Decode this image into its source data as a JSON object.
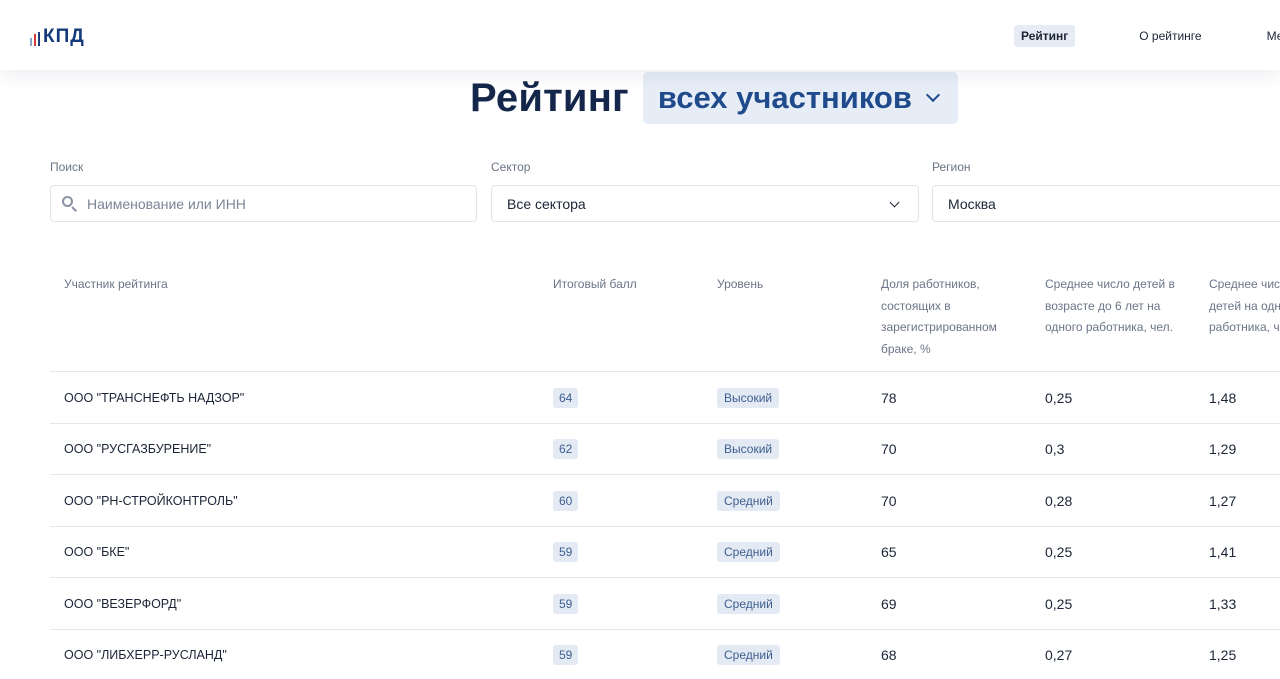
{
  "header": {
    "logo_text": "КПД",
    "nav": [
      {
        "label": "Рейтинг",
        "active": true
      },
      {
        "label": "О рейтинге",
        "active": false
      },
      {
        "label": "Мето",
        "active": false
      }
    ]
  },
  "title": {
    "main": "Рейтинг",
    "dropdown_value": "всех участников"
  },
  "filters": {
    "search": {
      "label": "Поиск",
      "placeholder": "Наименование или ИНН",
      "value": ""
    },
    "sector": {
      "label": "Сектор",
      "value": "Все сектора"
    },
    "region": {
      "label": "Регион",
      "value": "Москва"
    }
  },
  "table": {
    "columns": [
      "Участник рейтинга",
      "Итоговый балл",
      "Уровень",
      "Доля работников, состоящих в зарегистрированном браке, %",
      "Среднее число детей в возрасте до 6 лет на одного работника, чел.",
      "Среднее число детей на одного работника, чел."
    ],
    "rows": [
      {
        "name": "ООО \"ТРАНСНЕФТЬ НАДЗОР\"",
        "score": "64",
        "level": "Высокий",
        "married": "78",
        "kids_under6": "0,25",
        "kids_avg": "1,48"
      },
      {
        "name": "ООО \"РУСГАЗБУРЕНИЕ\"",
        "score": "62",
        "level": "Высокий",
        "married": "70",
        "kids_under6": "0,3",
        "kids_avg": "1,29"
      },
      {
        "name": "ООО \"РН-СТРОЙКОНТРОЛЬ\"",
        "score": "60",
        "level": "Средний",
        "married": "70",
        "kids_under6": "0,28",
        "kids_avg": "1,27"
      },
      {
        "name": "ООО \"БКЕ\"",
        "score": "59",
        "level": "Средний",
        "married": "65",
        "kids_under6": "0,25",
        "kids_avg": "1,41"
      },
      {
        "name": "ООО \"ВЕЗЕРФОРД\"",
        "score": "59",
        "level": "Средний",
        "married": "69",
        "kids_under6": "0,25",
        "kids_avg": "1,33"
      },
      {
        "name": "ООО \"ЛИБХЕРР-РУСЛАНД\"",
        "score": "59",
        "level": "Средний",
        "married": "68",
        "kids_under6": "0,27",
        "kids_avg": "1,25"
      }
    ]
  }
}
